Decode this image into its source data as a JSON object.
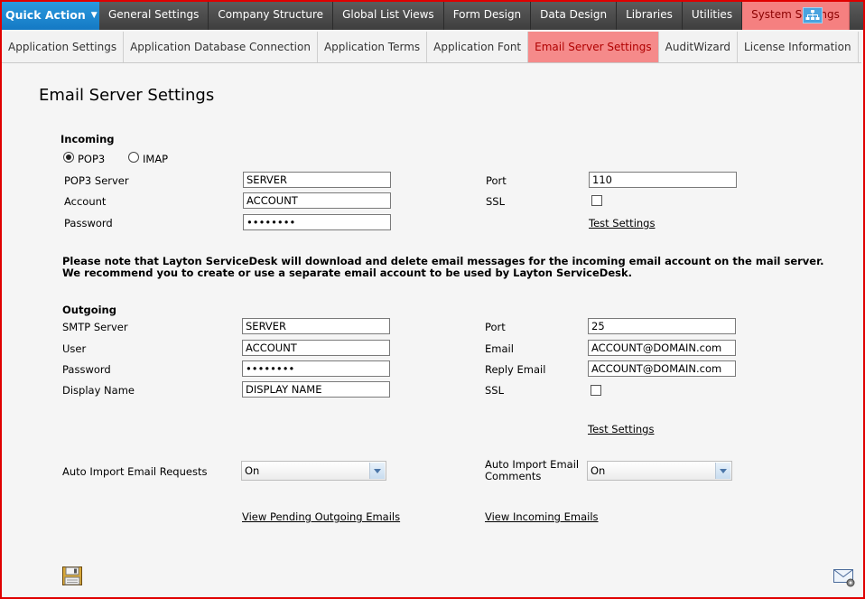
{
  "topnav": {
    "quick_action": "Quick Action",
    "items": [
      "General Settings",
      "Company Structure",
      "Global List Views",
      "Form Design",
      "Data Design",
      "Libraries",
      "Utilities",
      "System Settings"
    ]
  },
  "subnav": {
    "items": [
      "Application Settings",
      "Application Database Connection",
      "Application Terms",
      "Application Font",
      "Email Server Settings",
      "AuditWizard",
      "License Information"
    ]
  },
  "page_title": "Email Server Settings",
  "incoming": {
    "heading": "Incoming",
    "protocol_pop3": "POP3",
    "protocol_imap": "IMAP",
    "server_label": "POP3 Server",
    "server_value": "SERVER",
    "account_label": "Account",
    "account_value": "ACCOUNT",
    "password_label": "Password",
    "password_value": "••••••••",
    "port_label": "Port",
    "port_value": "110",
    "ssl_label": "SSL",
    "test_settings": "Test Settings"
  },
  "note": {
    "line1": "Please note that Layton ServiceDesk will download and delete email messages for the incoming email account on the mail server.",
    "line2": "We recommend you to create or use a separate email account to be used by Layton ServiceDesk."
  },
  "outgoing": {
    "heading": "Outgoing",
    "smtp_label": "SMTP Server",
    "smtp_value": "SERVER",
    "user_label": "User",
    "user_value": "ACCOUNT",
    "password_label": "Password",
    "password_value": "••••••••",
    "display_label": "Display Name",
    "display_value": "DISPLAY NAME",
    "port_label": "Port",
    "port_value": "25",
    "email_label": "Email",
    "email_value": "ACCOUNT@DOMAIN.com",
    "reply_label": "Reply Email",
    "reply_value": "ACCOUNT@DOMAIN.com",
    "ssl_label": "SSL",
    "test_settings": "Test Settings"
  },
  "auto_import": {
    "requests_label": "Auto Import Email Requests",
    "requests_value": "On",
    "comments_label_1": "Auto Import Email",
    "comments_label_2": "Comments",
    "comments_value": "On"
  },
  "links": {
    "pending": "View Pending Outgoing Emails",
    "incoming": "View Incoming Emails"
  },
  "colors": {
    "accent_blue": "#1f8ad6",
    "active_tab": "#f58080",
    "frame": "#e00000"
  }
}
